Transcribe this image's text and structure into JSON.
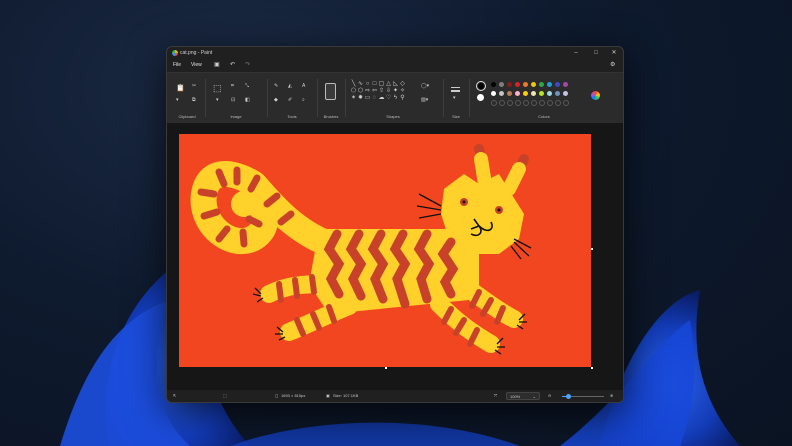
{
  "window": {
    "title": "cat.png - Paint"
  },
  "menu": {
    "file": "File",
    "view": "View"
  },
  "ribbon": {
    "groups": {
      "clipboard": "Clipboard",
      "image": "Image",
      "tools": "Tools",
      "brushes": "Brushes",
      "shapes": "Shapes",
      "size": "Size",
      "colors": "Colors"
    },
    "palette": [
      "#000000",
      "#7f7f7f",
      "#8b1a1a",
      "#e02020",
      "#f07828",
      "#f2c800",
      "#2fa84a",
      "#1fa0d8",
      "#3f48cc",
      "#a349a4",
      "#ffffff",
      "#c3c3c3",
      "#b97a57",
      "#ffaec9",
      "#ffc90e",
      "#efe4b0",
      "#b5e61d",
      "#99d9ea",
      "#7092be",
      "#c8bfe7"
    ],
    "primary_color": "#000000",
    "secondary_color": "#ffffff"
  },
  "status": {
    "dimensions": "1693 × 815px",
    "filesize": "Size: 107.1KB",
    "zoom": "100%"
  },
  "image": {
    "subject": "cat drawing",
    "background_color": "#f1461f",
    "cat_color": "#ffd12a",
    "stripe_color": "#c8422a"
  }
}
